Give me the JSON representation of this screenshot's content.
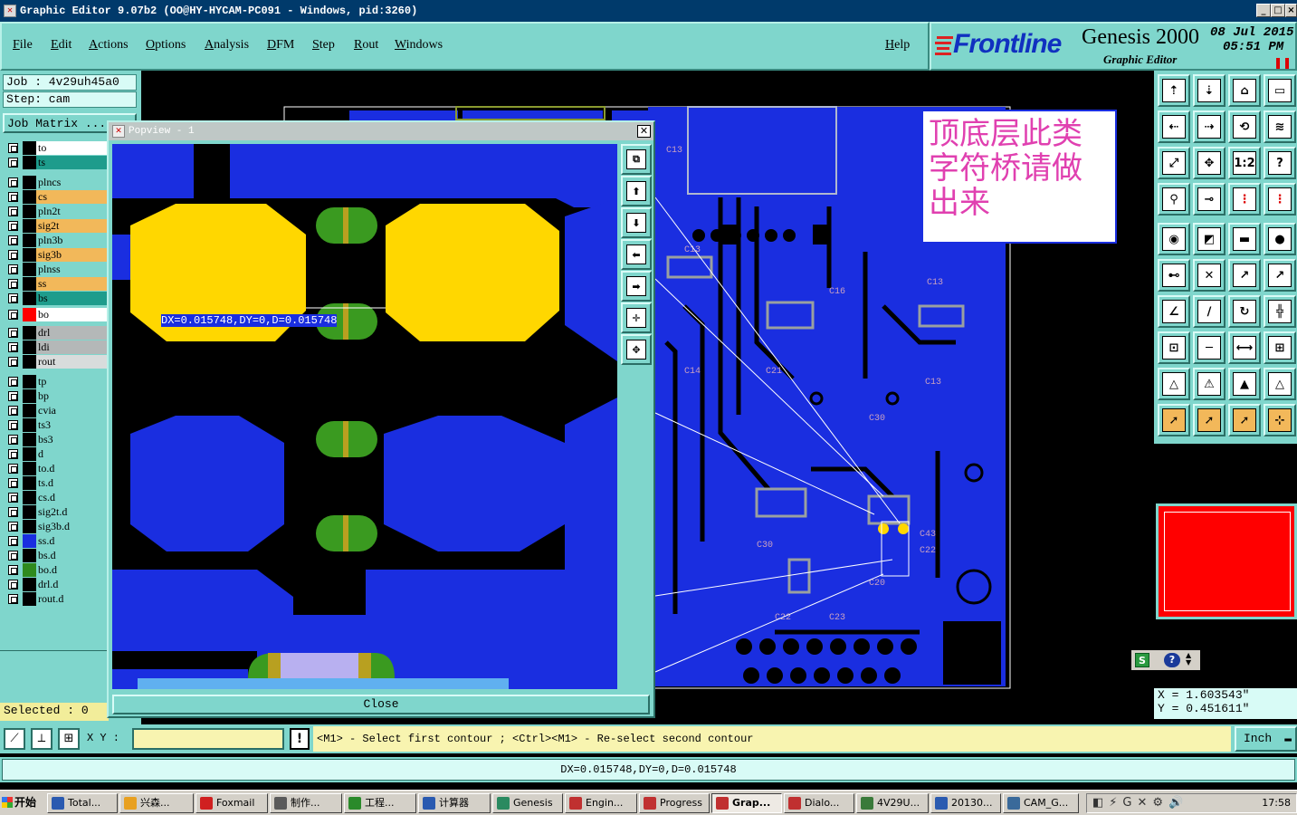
{
  "window": {
    "title": "Graphic Editor 9.07b2 (OO@HY-HYCAM-PC091 - Windows, pid:3260)",
    "min_label": "_",
    "max_label": "□",
    "close_label": "×"
  },
  "menu": {
    "items": [
      "File",
      "Edit",
      "Actions",
      "Options",
      "Analysis",
      "DFM",
      "Step",
      "Rout",
      "Windows"
    ],
    "help": "Help"
  },
  "brand": {
    "logo": "Frontline",
    "product": "Genesis 2000",
    "subtitle": "Graphic Editor",
    "date": "08 Jul 2015",
    "time": "05:51 PM"
  },
  "job": {
    "job_label": "Job : 4v29uh45a0",
    "step_label": "Step: cam",
    "matrix_button": "Job Matrix ..."
  },
  "layers": [
    {
      "name": "to",
      "color": "#ffffff",
      "swatch": "#000000"
    },
    {
      "name": "ts",
      "color": "#1e9c8c",
      "swatch": "#000000"
    },
    {
      "name": "plncs",
      "color": "#7fd6cc",
      "swatch": "#000000"
    },
    {
      "name": "cs",
      "color": "#f2b85a",
      "swatch": "#000000"
    },
    {
      "name": "pln2t",
      "color": "#7fd6cc",
      "swatch": "#000000"
    },
    {
      "name": "sig2t",
      "color": "#f2b85a",
      "swatch": "#000000"
    },
    {
      "name": "pln3b",
      "color": "#7fd6cc",
      "swatch": "#000000"
    },
    {
      "name": "sig3b",
      "color": "#f2b85a",
      "swatch": "#000000"
    },
    {
      "name": "plnss",
      "color": "#7fd6cc",
      "swatch": "#000000"
    },
    {
      "name": "ss",
      "color": "#f2b85a",
      "swatch": "#000000"
    },
    {
      "name": "bs",
      "color": "#1e9c8c",
      "swatch": "#000000"
    },
    {
      "name": "bo",
      "color": "#ffffff",
      "swatch": "#ff0000",
      "active": true
    },
    {
      "name": "drl",
      "color": "#b4b8b8",
      "swatch": "#000000"
    },
    {
      "name": "ldi",
      "color": "#b4b8b8",
      "swatch": "#000000"
    },
    {
      "name": "rout",
      "color": "#d8dcdc",
      "swatch": "#000000"
    },
    {
      "name": "tp",
      "color": "#7fd6cc",
      "swatch": "#000000"
    },
    {
      "name": "bp",
      "color": "#7fd6cc",
      "swatch": "#000000"
    },
    {
      "name": "cvia",
      "color": "#7fd6cc",
      "swatch": "#000000"
    },
    {
      "name": "ts3",
      "color": "#7fd6cc",
      "swatch": "#000000"
    },
    {
      "name": "bs3",
      "color": "#7fd6cc",
      "swatch": "#000000"
    },
    {
      "name": "d",
      "color": "#7fd6cc",
      "swatch": "#000000"
    },
    {
      "name": "to.d",
      "color": "#7fd6cc",
      "swatch": "#000000"
    },
    {
      "name": "ts.d",
      "color": "#7fd6cc",
      "swatch": "#000000"
    },
    {
      "name": "cs.d",
      "color": "#7fd6cc",
      "swatch": "#000000"
    },
    {
      "name": "sig2t.d",
      "color": "#7fd6cc",
      "swatch": "#000000"
    },
    {
      "name": "sig3b.d",
      "color": "#7fd6cc",
      "swatch": "#000000"
    },
    {
      "name": "ss.d",
      "color": "#7fd6cc",
      "swatch": "#1a2ee0"
    },
    {
      "name": "bs.d",
      "color": "#7fd6cc",
      "swatch": "#000000"
    },
    {
      "name": "bo.d",
      "color": "#7fd6cc",
      "swatch": "#2f8a1e"
    },
    {
      "name": "drl.d",
      "color": "#7fd6cc",
      "swatch": "#000000"
    },
    {
      "name": "rout.d",
      "color": "#7fd6cc",
      "swatch": "#000000"
    }
  ],
  "selected_label": "Selected : 0",
  "popview": {
    "title": "Popview - 1",
    "measure": "DX=0.015748,DY=0,D=0.015748",
    "close": "Close"
  },
  "annotation": "顶底层此类字符桥请做出来",
  "coords": {
    "x": "X = 1.603543\"",
    "y": "Y = 0.451611\""
  },
  "command": {
    "xy_label": "X Y :",
    "xy_value": "",
    "prompt": "<M1> - Select first contour ; <Ctrl><M1> - Re-select second contour",
    "units": "Inch"
  },
  "status_message": "DX=0.015748,DY=0,D=0.015748",
  "taskbar": {
    "start": "开始",
    "tasks": [
      "Total...",
      "兴森...",
      "Foxmail",
      "制作...",
      "工程...",
      "计算器",
      "Genesis",
      "Engin...",
      "Progress",
      "Grap...",
      "Dialo...",
      "4V29U...",
      "20130...",
      "CAM_G..."
    ],
    "clock": "17:58"
  },
  "colors": {
    "panel": "#7fd6cc",
    "copper": "#1a2ee0",
    "pad": "#ffd700",
    "silk": "#ffffff"
  }
}
